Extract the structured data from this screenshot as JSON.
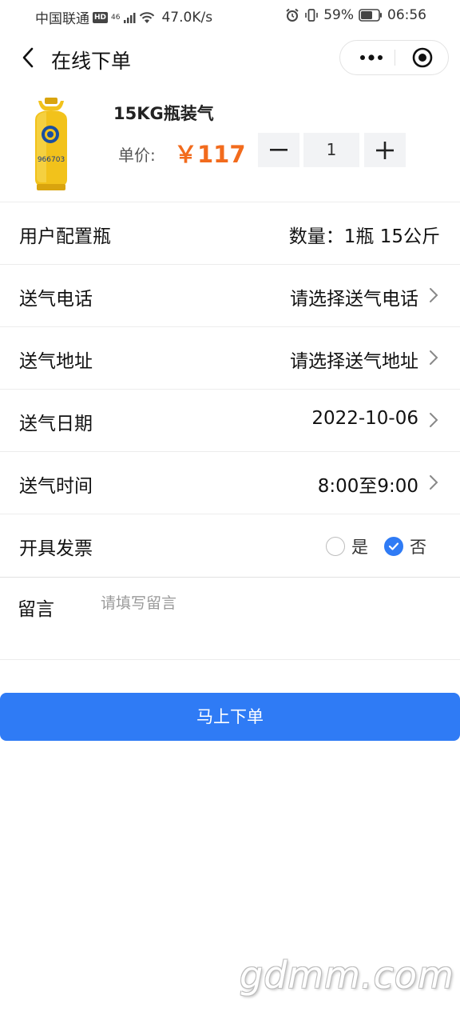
{
  "status_bar": {
    "carrier": "中国联通",
    "hd": "HD",
    "signal": "46",
    "speed": "47.0K/s",
    "battery": "59%",
    "time": "06:56"
  },
  "nav": {
    "title": "在线下单"
  },
  "product": {
    "name": "15KG瓶装气",
    "price_label": "单价:",
    "price": "￥117",
    "quantity": "1",
    "cylinder_text": "966703",
    "image_icon": "gas-cylinder-icon"
  },
  "rows": {
    "user_config": {
      "label": "用户配置瓶",
      "value": "数量：1瓶 15公斤"
    },
    "phone": {
      "label": "送气电话",
      "value": "请选择送气电话"
    },
    "address": {
      "label": "送气地址",
      "value": "请选择送气地址"
    },
    "date": {
      "label": "送气日期",
      "value": "2022-10-06"
    },
    "time": {
      "label": "送气时间",
      "value": "8:00至9:00"
    },
    "invoice": {
      "label": "开具发票",
      "option_yes": "是",
      "option_no": "否",
      "selected": "否"
    }
  },
  "message": {
    "label": "留言",
    "placeholder": "请填写留言"
  },
  "submit_label": "马上下单",
  "watermark": "gdmm.com",
  "colors": {
    "accent": "#2f7bf5",
    "price": "#f26b1d",
    "cylinder": "#f2c21b"
  }
}
